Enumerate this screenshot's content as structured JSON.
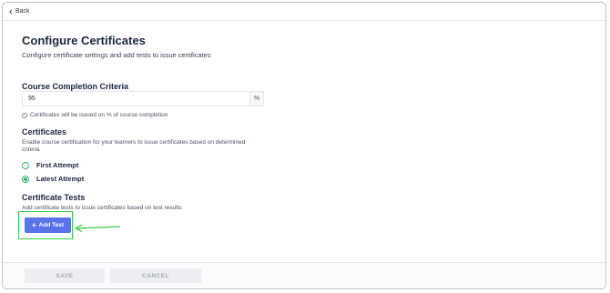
{
  "nav": {
    "back_label": "Back",
    "back_icon": "chevron-left-icon"
  },
  "header": {
    "title": "Configure Certificates",
    "subtitle": "Configure certificate settings and add tests to issue certificates"
  },
  "completion": {
    "title": "Course Completion Criteria",
    "value": "95",
    "suffix": "%",
    "info_icon": "info-icon",
    "info_text": "Certificates will be issued on % of course completion"
  },
  "certificates": {
    "title": "Certificates",
    "description": "Enable course certification for your learners to issue certificates based on determined criteria",
    "options": [
      {
        "label": "First Attempt",
        "selected": false
      },
      {
        "label": "Latest Attempt",
        "selected": true
      }
    ]
  },
  "tests": {
    "title": "Certificate Tests",
    "description": "Add certificate tests to issue certificates based on test results",
    "add_label": "Add Test",
    "add_icon": "plus-icon"
  },
  "footer": {
    "save_label": "SAVE",
    "cancel_label": "CANCEL"
  },
  "colors": {
    "accent": "#5b73e8",
    "radio": "#37b36b",
    "highlight": "#2ecc40"
  }
}
